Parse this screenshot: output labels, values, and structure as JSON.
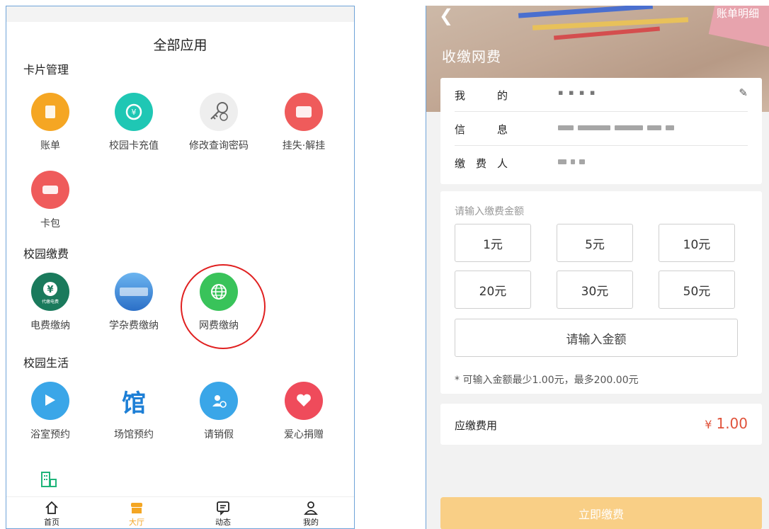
{
  "left": {
    "title": "全部应用",
    "sections": [
      {
        "title": "卡片管理",
        "apps": [
          {
            "label": "账单",
            "icon": "bill-icon",
            "color": "#f5a623"
          },
          {
            "label": "校园卡充值",
            "icon": "recharge-icon",
            "color": "#1fc7b4"
          },
          {
            "label": "修改查询密码",
            "icon": "key-icon",
            "color": "#eeeeee"
          },
          {
            "label": "挂失·解挂",
            "icon": "card-lock-icon",
            "color": "#ef5b5b"
          },
          {
            "label": "卡包",
            "icon": "card-wallet-icon",
            "color": "#ef5b5b"
          }
        ]
      },
      {
        "title": "校园缴费",
        "apps": [
          {
            "label": "电费缴纳",
            "icon": "electricity-icon",
            "color": "#1a7a5c",
            "sublabel": "代缴电费"
          },
          {
            "label": "学杂费缴纳",
            "icon": "tuition-icon",
            "color": "#3b7bd8"
          },
          {
            "label": "网费缴纳",
            "icon": "globe-icon",
            "color": "#39c35a",
            "highlighted": true
          }
        ]
      },
      {
        "title": "校园生活",
        "apps": [
          {
            "label": "浴室预约",
            "icon": "shower-icon",
            "color": "#3aa6e8"
          },
          {
            "label": "场馆预约",
            "icon": "venue-icon",
            "color": "#1d7fd6",
            "glyph": "馆"
          },
          {
            "label": "请销假",
            "icon": "leave-icon",
            "color": "#3aa6e8"
          },
          {
            "label": "爱心捐赠",
            "icon": "donate-heart-icon",
            "color": "#ef4b5b"
          }
        ]
      }
    ],
    "partial_app_icon": "building-icon",
    "tabs": [
      {
        "label": "首页",
        "icon": "home-icon"
      },
      {
        "label": "大厅",
        "icon": "hall-icon",
        "active": true
      },
      {
        "label": "动态",
        "icon": "message-icon"
      },
      {
        "label": "我的",
        "icon": "profile-icon"
      }
    ]
  },
  "right": {
    "back_icon": "back-chevron-icon",
    "bill_link": "账单明细",
    "title": "收缴网费",
    "info": {
      "edit_icon": "edit-pencil-icon",
      "rows": [
        {
          "key": "我　　　的",
          "value": "▪ ▪ ▪ ▪"
        },
        {
          "key": "信　　　息",
          "value": ""
        },
        {
          "key": "缴　费　人",
          "value": ""
        }
      ]
    },
    "amount": {
      "hint": "请输入缴费金额",
      "options": [
        "1元",
        "5元",
        "10元",
        "20元",
        "30元",
        "50元"
      ],
      "input_placeholder": "请输入金额",
      "note": "* 可输入金额最少1.00元，最多200.00元"
    },
    "due": {
      "label": "应缴费用",
      "currency": "¥",
      "value": "1.00"
    },
    "pay_button": "立即缴费",
    "colors": {
      "accent": "#f4a623",
      "price": "#e0523a",
      "pay_button": "#f9cf86",
      "highlight_circle": "#e02020"
    }
  }
}
